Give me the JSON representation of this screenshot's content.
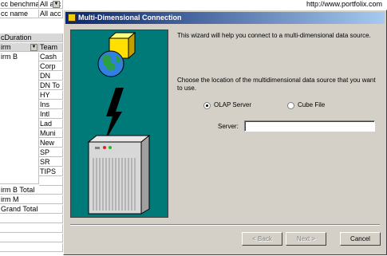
{
  "sheet": {
    "row1": [
      "cc benchma",
      "All acc"
    ],
    "row2": [
      "cc name",
      "All acc"
    ],
    "url": "http://www.portfolix.com",
    "header_duration": "cDuration",
    "col_firm": "irm",
    "col_team": "Team",
    "firm_b": "irm B",
    "teams": [
      "Cash",
      "Corp",
      "DN",
      "DN To",
      "HY",
      "Ins",
      "Intl",
      "Lad",
      "Muni",
      "New",
      "SP",
      "SR",
      "TIPS"
    ],
    "firm_b_total": "irm B Total",
    "firm_m": "irm M",
    "grand_total": "Grand Total"
  },
  "dialog": {
    "title": "Multi-Dimensional Connection",
    "intro": "This wizard will help you connect to a multi-dimensional data source.",
    "choose": "Choose the location of the multidimensional data source that you want to use.",
    "radio_olap": "OLAP Server",
    "radio_cube": "Cube File",
    "server_label": "Server:",
    "server_value": "",
    "btn_back": "< Back",
    "btn_next": "Next >",
    "btn_cancel": "Cancel"
  },
  "colors": {
    "title_start": "#0a246a",
    "art_bg": "#007a78",
    "dialog_face": "#d4d0c8"
  },
  "icons": [
    "cube-icon",
    "globe-icon",
    "lightning-icon",
    "server-icon"
  ]
}
